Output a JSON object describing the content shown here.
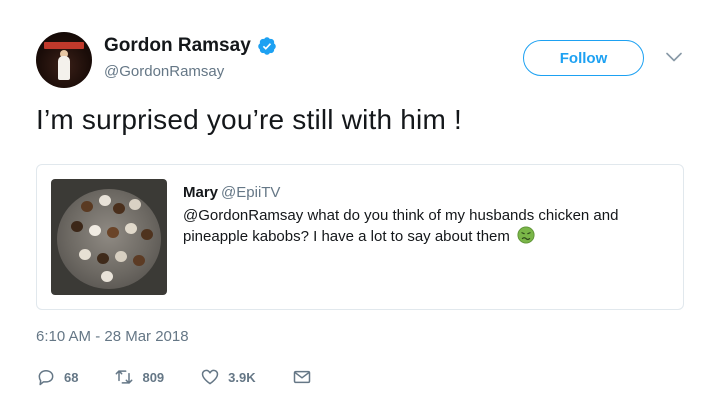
{
  "author": {
    "name": "Gordon Ramsay",
    "handle": "@GordonRamsay",
    "verified": true,
    "avatar_icon": "avatar-photo"
  },
  "follow_button": {
    "label": "Follow"
  },
  "tweet": {
    "text": "I’m surprised you’re still with him !",
    "timestamp": "6:10 AM - 28 Mar 2018"
  },
  "quoted_tweet": {
    "name": "Mary",
    "handle": "@EpiiTV",
    "text": "@GordonRamsay what do you think of my husbands chicken and pineapple kabobs? I have a lot to say about them",
    "emoji_icon": "nauseated-face-icon",
    "image_icon": "kabobs-photo"
  },
  "actions": {
    "replies": "68",
    "retweets": "809",
    "likes": "3.9K"
  },
  "colors": {
    "brand_blue": "#1da1f2",
    "secondary_text": "#657786",
    "border": "#e1e8ed"
  }
}
